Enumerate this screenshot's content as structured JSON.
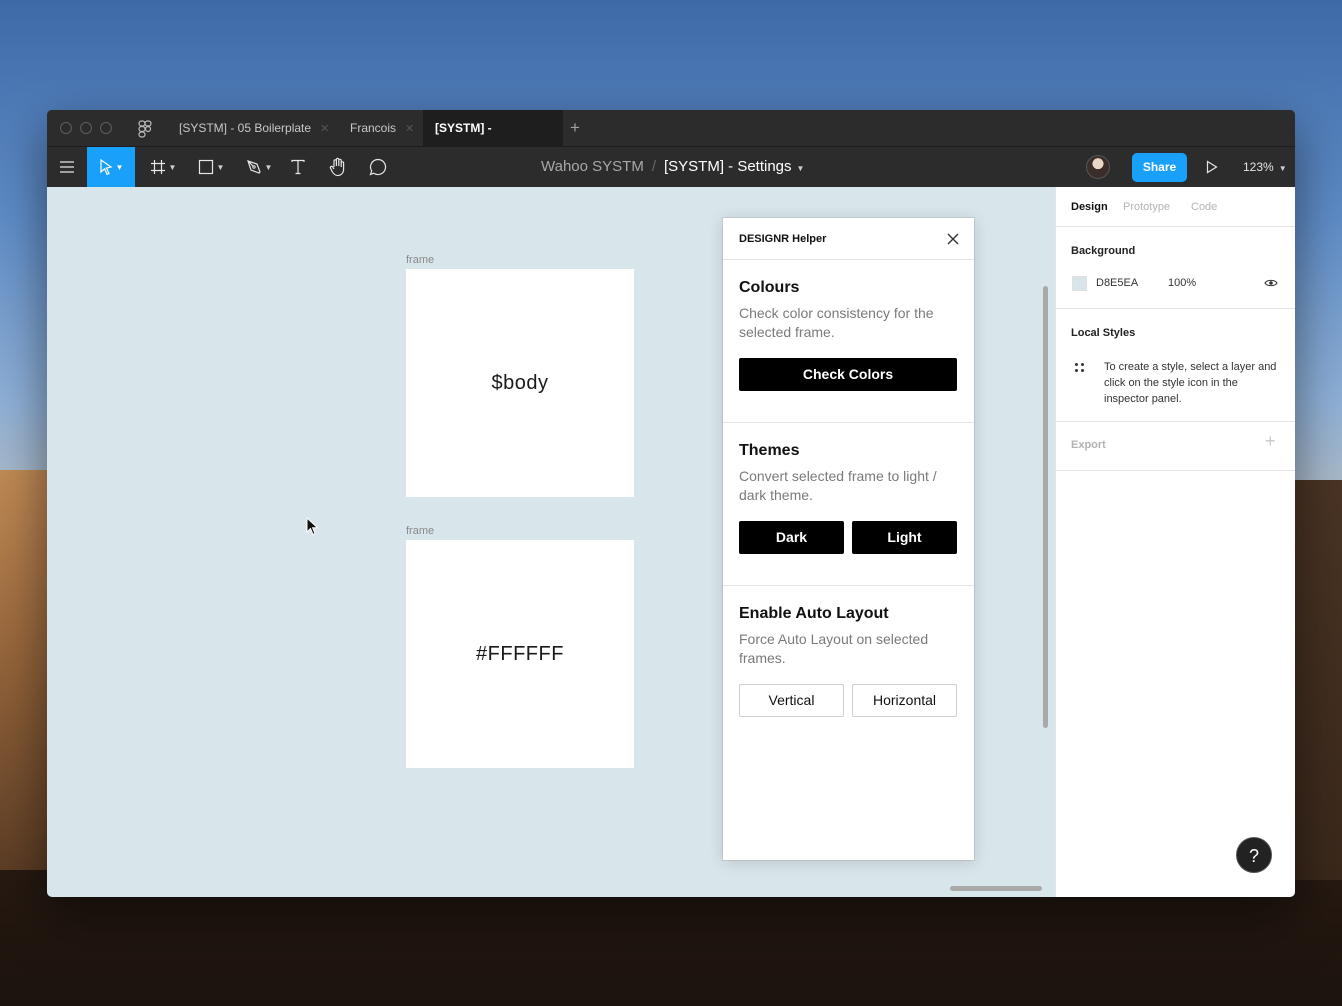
{
  "tabs": [
    {
      "label": "[SYSTM] - 05 Boilerplate",
      "active": false
    },
    {
      "label": "Francois",
      "active": false
    },
    {
      "label": "[SYSTM] - Settings",
      "active": true
    }
  ],
  "toolbar": {
    "breadcrumb_team": "Wahoo SYSTM",
    "breadcrumb_sep": "/",
    "breadcrumb_file": "[SYSTM] - Settings",
    "share_label": "Share",
    "zoom": "123%",
    "tools": [
      "menu-icon",
      "move-icon",
      "frame-icon",
      "rectangle-icon",
      "pen-icon",
      "text-icon",
      "hand-icon",
      "comment-icon"
    ]
  },
  "canvas": {
    "background": "#d8e5ea",
    "frames": [
      {
        "label": "frame",
        "text": "$body"
      },
      {
        "label": "frame",
        "text": "#FFFFFF"
      }
    ]
  },
  "plugin": {
    "title": "DESIGNR Helper",
    "sections": [
      {
        "title": "Colours",
        "description": "Check color consistency for the selected frame.",
        "buttons": [
          "Check Colors"
        ]
      },
      {
        "title": "Themes",
        "description": "Convert selected frame to light / dark theme.",
        "buttons": [
          "Dark",
          "Light"
        ]
      },
      {
        "title": "Enable Auto Layout",
        "description": "Force Auto Layout on selected frames.",
        "buttons": [
          "Vertical",
          "Horizontal"
        ]
      }
    ]
  },
  "panel": {
    "tabs": [
      "Design",
      "Prototype",
      "Code"
    ],
    "background": {
      "title": "Background",
      "hex": "D8E5EA",
      "opacity": "100%"
    },
    "local_styles": {
      "title": "Local Styles",
      "hint": "To create a style, select a layer and click on the style icon in the inspector panel."
    },
    "export": {
      "title": "Export"
    },
    "help": "?"
  },
  "colors": {
    "accent": "#18a0fb",
    "canvas": "#d8e5ea",
    "chrome": "#2c2c2c"
  }
}
